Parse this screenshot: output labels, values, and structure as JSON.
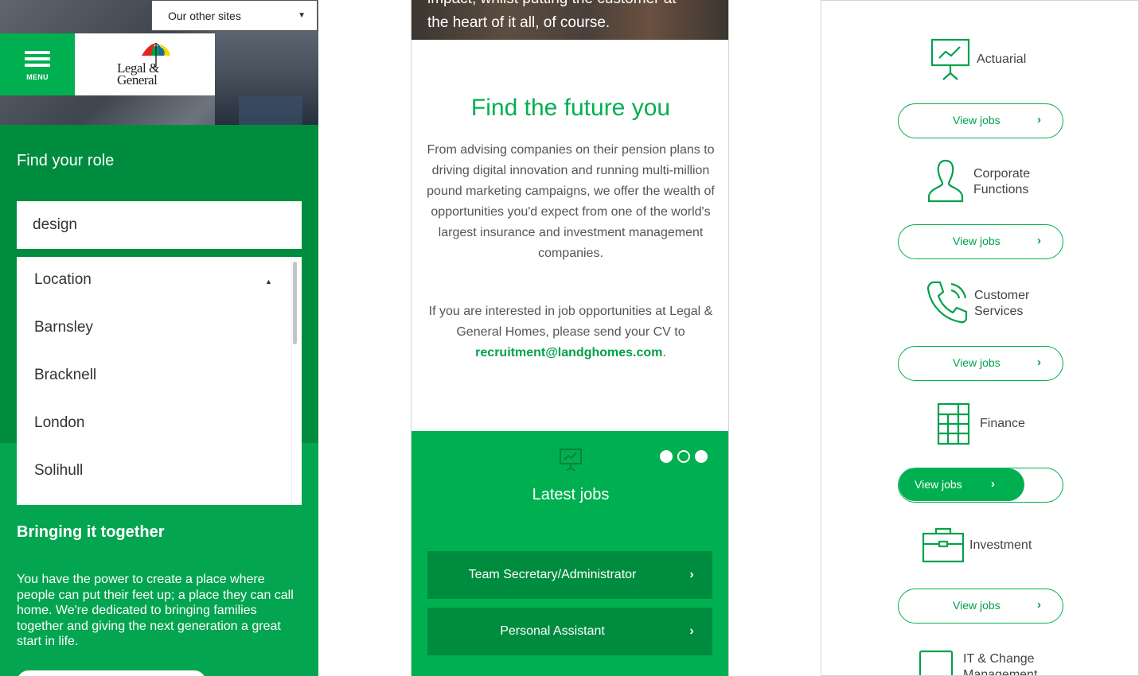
{
  "panel1": {
    "sites_select": {
      "label": "Our other sites"
    },
    "menu": {
      "label": "MENU"
    },
    "logo": {
      "line1": "Legal &",
      "line2": "General"
    },
    "find_title": "Find your role",
    "search": {
      "value": "design"
    },
    "location": {
      "header": "Location",
      "options": [
        "Barnsley",
        "Bracknell",
        "London",
        "Solihull"
      ]
    },
    "bringing": {
      "title": "Bringing it together",
      "text": "You have the power to create a place where people can put their feet up; a place they can call home. We're dedicated to bringing families together and giving the next generation a great start in life."
    }
  },
  "panel2": {
    "hero_top": "impact, whilst putting the customer at",
    "hero_text": "the heart of it all, of course.",
    "title": "Find the future you",
    "para1": "From advising companies on their pension plans to driving digital innovation and running multi-million pound marketing campaigns, we offer the wealth of opportunities you'd expect from one of the world's largest insurance and investment management companies.",
    "para2_prefix": "If you are interested in job opportunities at Legal & General Homes, please send your CV to",
    "email": "recruitment@landghomes.com",
    "para2_suffix": ".",
    "latest_title": "Latest jobs",
    "jobs": [
      "Team Secretary/Administrator",
      "Personal Assistant"
    ]
  },
  "panel3": {
    "categories": [
      {
        "label": "Actuarial",
        "icon": "presentation-chart-icon"
      },
      {
        "label": "Corporate\nFunctions",
        "icon": "person-icon"
      },
      {
        "label": "Customer\nServices",
        "icon": "phone-icon"
      },
      {
        "label": "Finance",
        "icon": "calculator-icon"
      },
      {
        "label": "Investment",
        "icon": "briefcase-icon"
      },
      {
        "label": "IT & Change\nManagement",
        "icon": "monitor-icon"
      }
    ],
    "view_jobs_label": "View jobs"
  },
  "colors": {
    "brand_green": "#00b050",
    "dark_green": "#008c3f",
    "mid_green": "#04a550"
  }
}
